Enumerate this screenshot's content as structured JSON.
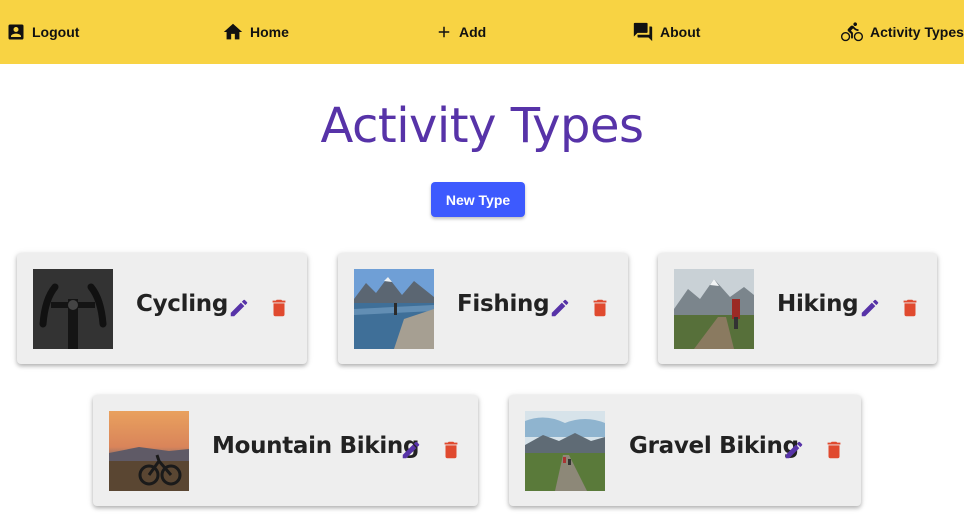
{
  "nav": {
    "logout": "Logout",
    "home": "Home",
    "add": "Add",
    "about": "About",
    "activity_types": "Activity Types"
  },
  "page": {
    "title": "Activity Types",
    "new_button": "New Type"
  },
  "colors": {
    "navbar": "#f8d343",
    "title": "#5733a8",
    "button": "#3d5afe",
    "edit_icon": "#5733a8",
    "delete_icon": "#e04a2f",
    "card": "#eeeeee"
  },
  "activity_types": [
    {
      "name": "Cycling",
      "image": "handlebar-photo"
    },
    {
      "name": "Fishing",
      "image": "lake-mountain-photo"
    },
    {
      "name": "Hiking",
      "image": "mountain-trail-photo"
    },
    {
      "name": "Mountain Biking",
      "image": "bike-sunset-photo"
    },
    {
      "name": "Gravel Biking",
      "image": "gravel-road-photo"
    }
  ]
}
